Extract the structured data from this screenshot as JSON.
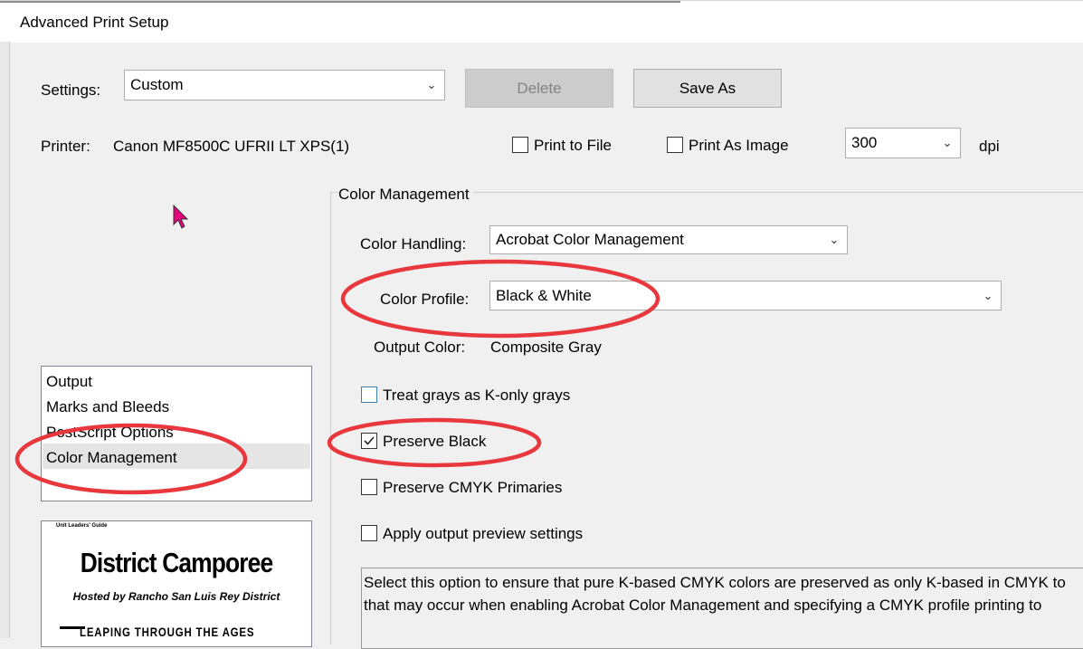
{
  "window": {
    "title": "Advanced Print Setup"
  },
  "settings": {
    "label": "Settings:",
    "value": "Custom",
    "delete_label": "Delete",
    "save_as_label": "Save As"
  },
  "printer": {
    "label": "Printer:",
    "name": "Canon MF8500C UFRII LT XPS(1)",
    "print_to_file_label": "Print to File",
    "print_to_file_checked": false,
    "print_as_image_label": "Print As Image",
    "print_as_image_checked": false,
    "dpi_value": "300",
    "dpi_unit": "dpi"
  },
  "nav": {
    "items": [
      {
        "label": "Output"
      },
      {
        "label": "Marks and Bleeds"
      },
      {
        "label": "PostScript Options"
      },
      {
        "label": "Color Management",
        "selected": true
      }
    ]
  },
  "preview": {
    "small_text": "Unit Leaders' Guide",
    "heading": "District Camporee",
    "subheading": "Hosted by Rancho San Luis Rey District",
    "banner": "LEAPING THROUGH THE AGES"
  },
  "color_management": {
    "section_title": "Color Management",
    "handling_label": "Color Handling:",
    "handling_value": "Acrobat Color Management",
    "profile_label": "Color Profile:",
    "profile_value": "Black & White",
    "output_label": "Output Color:",
    "output_value": "Composite Gray",
    "options": [
      {
        "label": "Treat grays as K-only grays",
        "checked": false
      },
      {
        "label": "Preserve Black",
        "checked": true
      },
      {
        "label": "Preserve CMYK Primaries",
        "checked": false
      },
      {
        "label": "Apply output preview settings",
        "checked": false
      }
    ],
    "description_lines": [
      "Select this option to ensure that pure K-based CMYK colors are preserved as only K-based in CMYK to",
      "that may occur when enabling Acrobat Color Management and specifying a CMYK profile printing to"
    ]
  },
  "colors": {
    "annotation_red": "#e8383d",
    "cursor_magenta": "#e6007e",
    "checkbox_blue": "#3c7fb1"
  }
}
